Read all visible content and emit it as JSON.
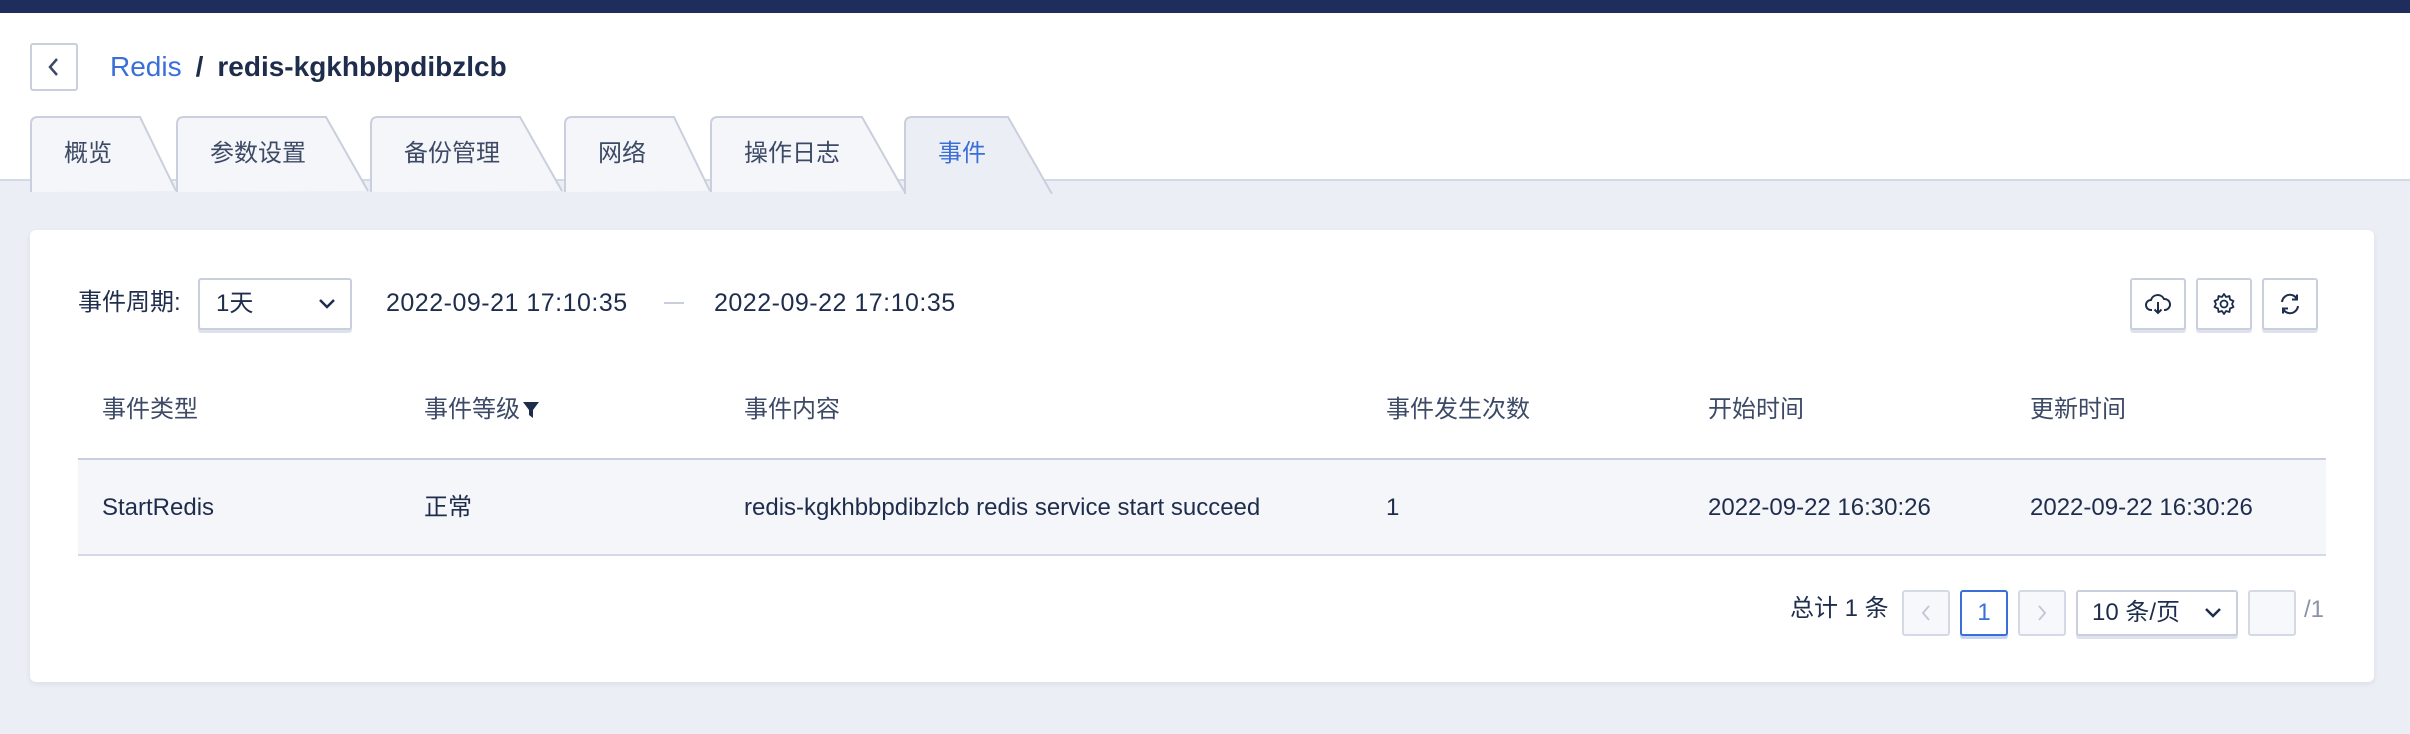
{
  "breadcrumb": {
    "parent": "Redis",
    "separator": "/",
    "current": "redis-kgkhbbpdibzlcb"
  },
  "tabs": [
    {
      "label": "概览",
      "active": false
    },
    {
      "label": "参数设置",
      "active": false
    },
    {
      "label": "备份管理",
      "active": false
    },
    {
      "label": "网络",
      "active": false
    },
    {
      "label": "操作日志",
      "active": false
    },
    {
      "label": "事件",
      "active": true
    }
  ],
  "filter": {
    "period_label": "事件周期:",
    "period_value": "1天",
    "start_time": "2022-09-21 17:10:35",
    "end_time": "2022-09-22 17:10:35"
  },
  "toolbar": {
    "icons": [
      "cloud-download-icon",
      "gear-icon",
      "refresh-icon"
    ]
  },
  "table": {
    "columns": [
      "事件类型",
      "事件等级",
      "事件内容",
      "事件发生次数",
      "开始时间",
      "更新时间"
    ],
    "rows": [
      [
        "StartRedis",
        "正常",
        "redis-kgkhbbpdibzlcb redis service start succeed",
        "1",
        "2022-09-22 16:30:26",
        "2022-09-22 16:30:26"
      ]
    ]
  },
  "pagination": {
    "total": "总计 1 条",
    "current_page": "1",
    "page_size": "10 条/页",
    "jump_value": "",
    "page_count": "/1"
  },
  "colors": {
    "accent": "#3b6fd8",
    "topbar": "#1f2d5c",
    "background": "#eceef5"
  }
}
